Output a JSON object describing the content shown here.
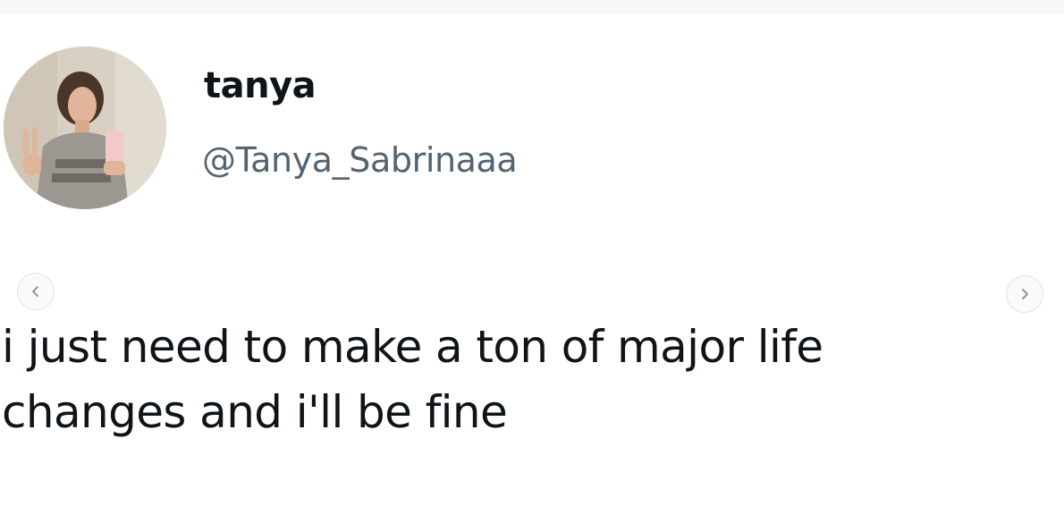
{
  "tweet": {
    "display_name": "tanya",
    "handle": "@Tanya_Sabrinaaa",
    "text_line_1": "i just need to make a ton of major life",
    "text_line_2": "changes and i'll be fine"
  },
  "carousel": {
    "prev_icon": "chevron-left-icon",
    "next_icon": "chevron-right-icon"
  },
  "colors": {
    "text": "#0f1419",
    "handle": "#536471",
    "background": "#ffffff"
  }
}
